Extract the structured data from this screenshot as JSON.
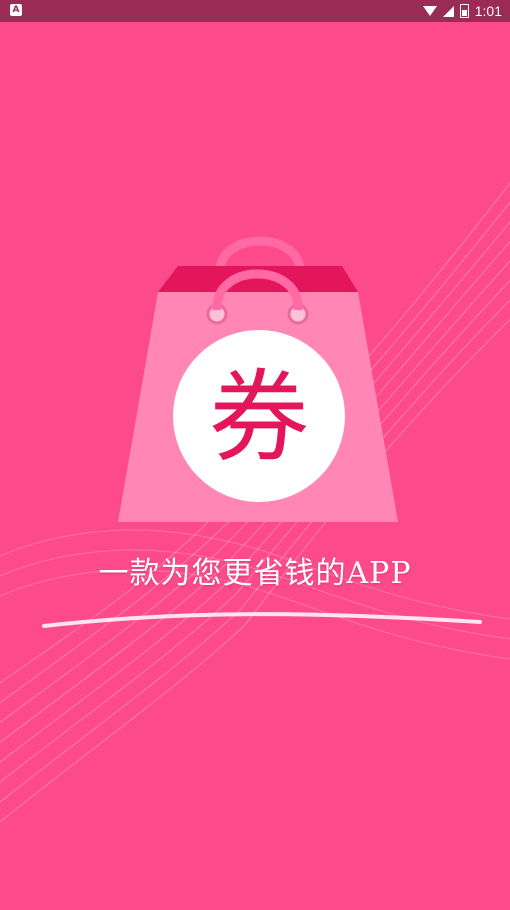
{
  "status_bar": {
    "notification_icon": "A",
    "time": "1:01",
    "icons": [
      "wifi-icon",
      "signal-icon",
      "battery-icon"
    ]
  },
  "splash": {
    "coupon_glyph": "券",
    "tagline": "一款为您更省钱的APP"
  },
  "colors": {
    "background": "#fd4a8a",
    "status_bar": "#9a2b55",
    "bag_body": "#ff86b5",
    "bag_top": "#e3155b",
    "circle": "#ffffff",
    "glyph": "#e3155b"
  }
}
